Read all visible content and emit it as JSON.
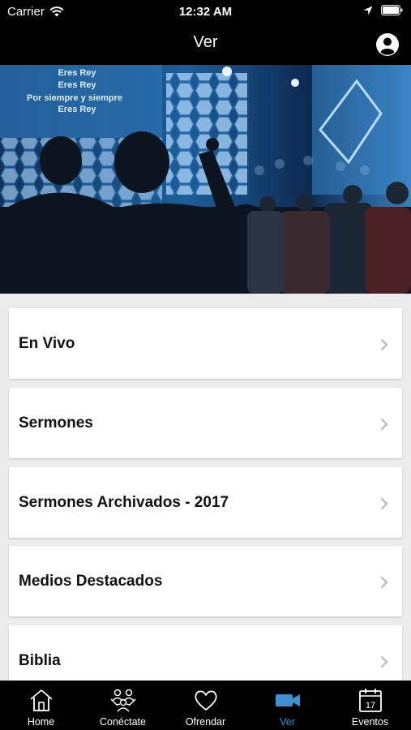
{
  "status_bar": {
    "carrier": "Carrier",
    "time": "12:32 AM"
  },
  "nav": {
    "title": "Ver",
    "profile_icon": "person-circle-icon"
  },
  "hero": {
    "description": "worship-crowd-photo",
    "screen_lyrics": [
      "Eres Rey",
      "Eres Rey",
      "Por siempre y siempre",
      "Eres Rey"
    ]
  },
  "menu": {
    "items": [
      {
        "label": "En Vivo"
      },
      {
        "label": "Sermones"
      },
      {
        "label": "Sermones Archivados - 2017"
      },
      {
        "label": "Medios Destacados"
      },
      {
        "label": "Biblia"
      }
    ]
  },
  "tabs": [
    {
      "label": "Home",
      "icon": "house-icon",
      "active": false
    },
    {
      "label": "Conéctate",
      "icon": "group-icon",
      "active": false
    },
    {
      "label": "Ofrendar",
      "icon": "heart-icon",
      "active": false
    },
    {
      "label": "Ver",
      "icon": "video-camera-icon",
      "active": true
    },
    {
      "label": "Eventos",
      "icon": "calendar-icon",
      "active": false
    }
  ],
  "colors": {
    "accent": "#3f8fd0",
    "bar_bg": "#000000",
    "list_bg": "#ececec"
  },
  "calendar_day": "17"
}
